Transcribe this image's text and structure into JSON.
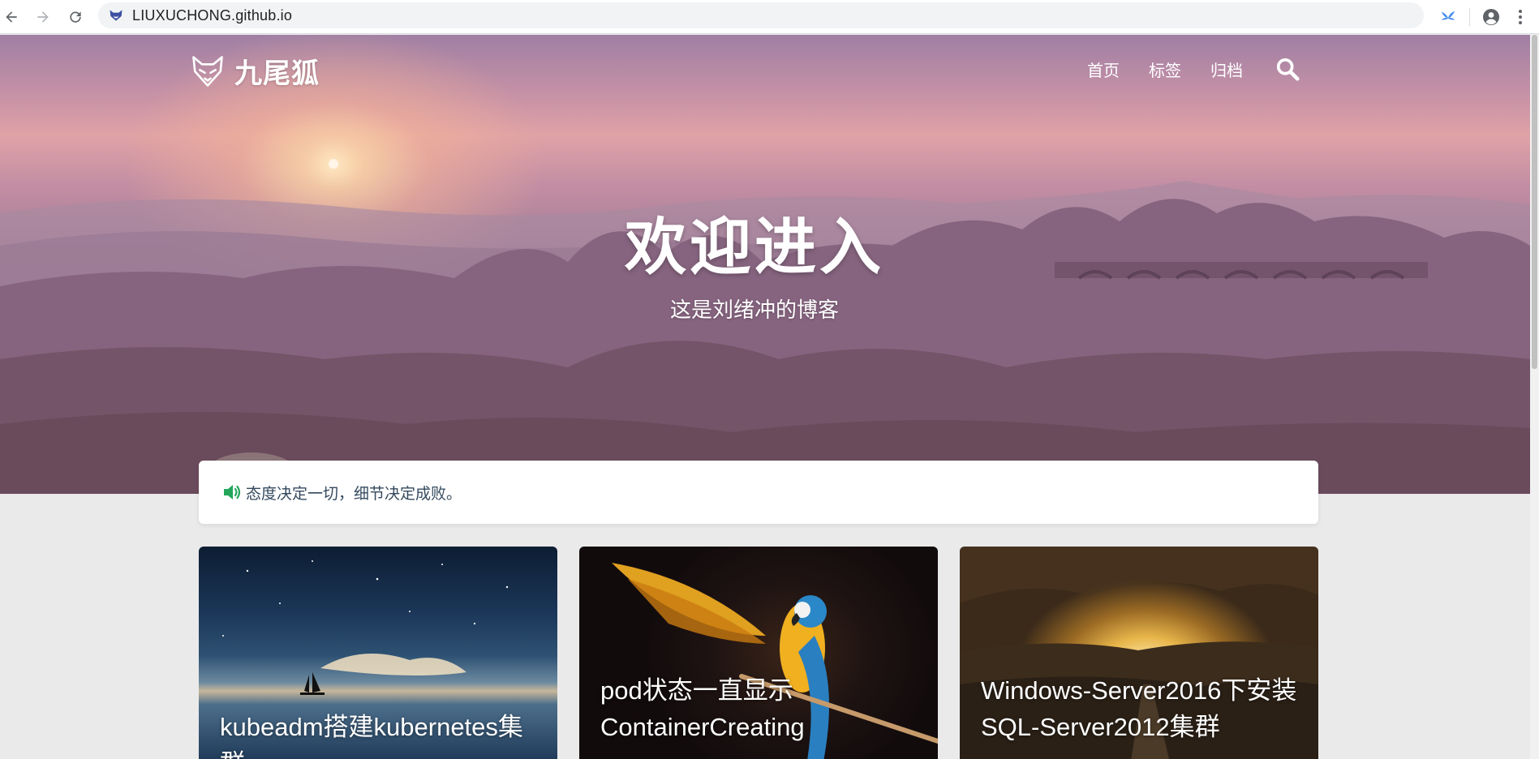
{
  "browser": {
    "url": "LIUXUCHONG.github.io",
    "icons": {
      "back": "arrow-left-icon",
      "forward": "arrow-right-icon",
      "reload": "reload-icon",
      "extension": "extension-bird-icon",
      "profile": "account-circle-icon",
      "menu": "vertical-dots-icon"
    }
  },
  "site": {
    "logo_text": "九尾狐",
    "logo_icon": "fox-icon",
    "nav": [
      {
        "label": "首页"
      },
      {
        "label": "标签"
      },
      {
        "label": "归档"
      }
    ],
    "search_icon": "search-icon"
  },
  "hero": {
    "title": "欢迎进入",
    "subtitle": "这是刘绪冲的博客"
  },
  "notice": {
    "icon": "speaker-icon",
    "text": "态度决定一切，细节决定成败。"
  },
  "posts": [
    {
      "title": "kubeadm搭建kubernetes集群"
    },
    {
      "title": "pod状态一直显示ContainerCreating"
    },
    {
      "title": "Windows-Server2016下安装SQL-Server2012集群"
    }
  ],
  "colors": {
    "accent_green": "#23a65a",
    "notice_text": "#34495e"
  }
}
